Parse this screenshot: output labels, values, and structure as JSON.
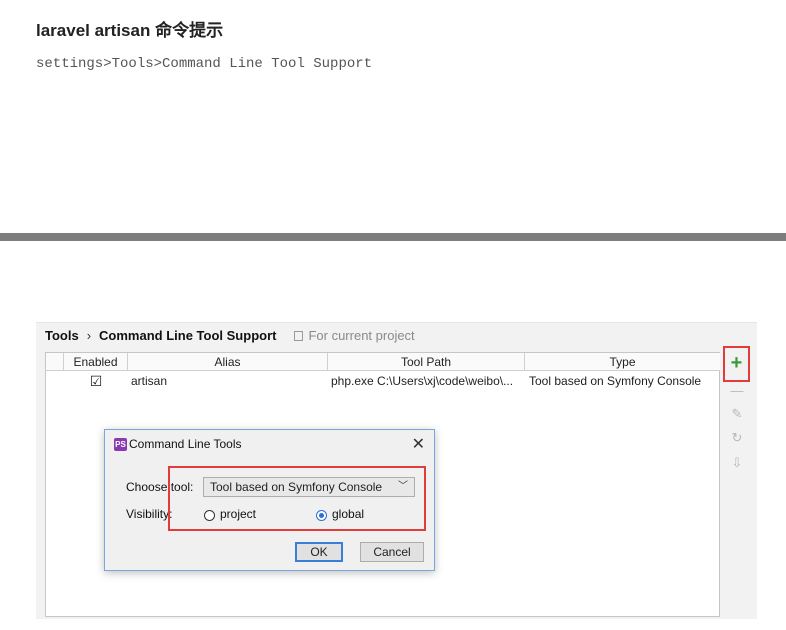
{
  "note": {
    "title": "laravel artisan 命令提示",
    "path_code": "settings>Tools>Command Line Tool Support"
  },
  "ide": {
    "breadcrumb": {
      "root": "Tools",
      "separator": "›",
      "current": "Command Line Tool Support",
      "scope": "For current project"
    },
    "table": {
      "headers": {
        "enabled": "Enabled",
        "alias": "Alias",
        "tool_path": "Tool Path",
        "type": "Type"
      },
      "rows": [
        {
          "enabled_mark": "☑",
          "alias": "artisan",
          "tool_path": "php.exe C:\\Users\\xj\\code\\weibo\\...",
          "type": "Tool based on Symfony Console"
        }
      ]
    },
    "toolbar": {
      "add": "+",
      "remove": "—",
      "edit": "✎",
      "reload": "↻",
      "export": "⇩"
    },
    "dialog": {
      "title": "Command Line Tools",
      "app_icon": "PS",
      "close": "✕",
      "choose_tool_label": "Choose tool:",
      "choose_tool_value": "Tool based on Symfony Console",
      "visibility_label": "Visibility:",
      "option_project": "project",
      "option_global": "global",
      "selected_visibility": "global",
      "ok": "OK",
      "cancel": "Cancel"
    }
  },
  "colors": {
    "highlight": "#e23b3b",
    "accent": "#2a6fd6",
    "add_green": "#3a9a3a"
  }
}
